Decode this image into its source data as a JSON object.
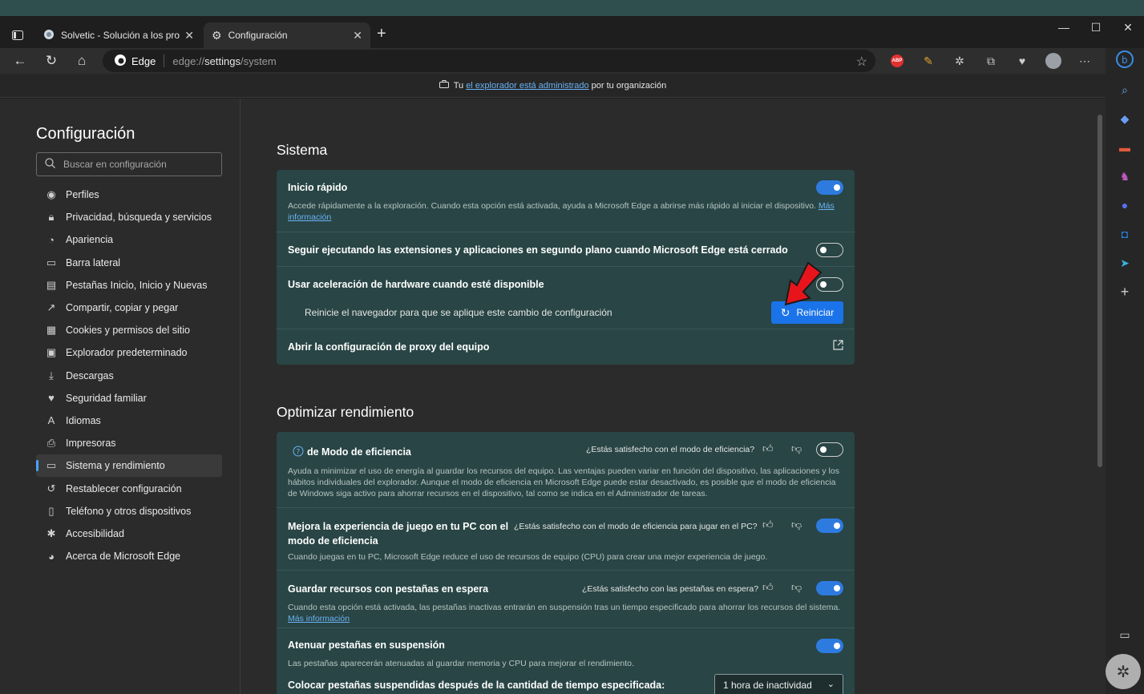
{
  "tabs": [
    {
      "title": "Solvetic - Solución a los problem",
      "active": false
    },
    {
      "title": "Configuración",
      "active": true
    }
  ],
  "toolbar": {
    "address_site": "Edge",
    "url_prefix": "edge://",
    "url_path": "settings",
    "url_suffix": "/system",
    "abp_label": "ABP"
  },
  "infobar": {
    "prefix": "Tu",
    "link": "el explorador está administrado",
    "suffix": "por tu organización"
  },
  "sidebar": {
    "title": "Configuración",
    "search_placeholder": "Buscar en configuración",
    "items": [
      {
        "label": "Perfiles",
        "icon": "profile-icon"
      },
      {
        "label": "Privacidad, búsqueda y servicios",
        "icon": "lock-icon"
      },
      {
        "label": "Apariencia",
        "icon": "palette-icon"
      },
      {
        "label": "Barra lateral",
        "icon": "sidebar-icon"
      },
      {
        "label": "Pestañas Inicio, Inicio y Nuevas",
        "icon": "tabs-icon"
      },
      {
        "label": "Compartir, copiar y pegar",
        "icon": "share-icon"
      },
      {
        "label": "Cookies y permisos del sitio",
        "icon": "cookie-icon"
      },
      {
        "label": "Explorador predeterminado",
        "icon": "browser-icon"
      },
      {
        "label": "Descargas",
        "icon": "download-icon"
      },
      {
        "label": "Seguridad familiar",
        "icon": "family-icon"
      },
      {
        "label": "Idiomas",
        "icon": "language-icon"
      },
      {
        "label": "Impresoras",
        "icon": "printer-icon"
      },
      {
        "label": "Sistema y rendimiento",
        "icon": "system-icon",
        "active": true
      },
      {
        "label": "Restablecer configuración",
        "icon": "reset-icon"
      },
      {
        "label": "Teléfono y otros dispositivos",
        "icon": "phone-icon"
      },
      {
        "label": "Accesibilidad",
        "icon": "accessibility-icon"
      },
      {
        "label": "Acerca de Microsoft Edge",
        "icon": "edge-logo-icon"
      }
    ]
  },
  "system": {
    "title": "Sistema",
    "startup_boost": {
      "title": "Inicio rápido",
      "desc": "Accede rápidamente a la exploración. Cuando esta opción está activada, ayuda a Microsoft Edge a abrirse más rápido al iniciar el dispositivo.",
      "link_a": "Más",
      "link_b": "información",
      "enabled": true
    },
    "background_apps": {
      "title": "Seguir ejecutando las extensiones y aplicaciones en segundo plano cuando Microsoft Edge está cerrado",
      "enabled": false
    },
    "hardware_accel": {
      "title": "Usar aceleración de hardware cuando esté disponible",
      "enabled": false,
      "restart_msg": "Reinicie el navegador para que se aplique este cambio de configuración",
      "restart_label": "Reiniciar"
    },
    "proxy": {
      "title": "Abrir la configuración de proxy del equipo"
    }
  },
  "performance": {
    "title": "Optimizar rendimiento",
    "efficiency": {
      "title": "de Modo de eficiencia",
      "question": "¿Estás satisfecho con el modo de eficiencia?",
      "desc1": "Ayuda a minimizar el uso de energía al guardar los recursos del equipo. Las ventajas pueden variar en función del dispositivo, las aplicaciones y los",
      "desc2": "hábitos individuales del explorador. Aunque el modo de eficiencia en Microsoft Edge puede estar desactivado, es posible que el modo de eficiencia",
      "desc3": "de Windows siga activo para ahorrar recursos en el dispositivo, tal como se indica en el Administrador de tareas.",
      "enabled": false
    },
    "gaming": {
      "title1": "Mejora la experiencia de juego en tu PC con el",
      "title2": "modo de eficiencia",
      "question": "¿Estás satisfecho con el modo de eficiencia para jugar en el PC?",
      "desc": "Cuando juegas en tu PC, Microsoft Edge reduce el uso de recursos de equipo (CPU) para crear una mejor experiencia de juego.",
      "enabled": true
    },
    "sleeping_tabs": {
      "title": "Guardar recursos con pestañas en espera",
      "question": "¿Estás satisfecho con las pestañas en espera?",
      "desc": "Cuando esta opción está activada, las pestañas inactivas entrarán en suspensión tras un tiempo especificado para ahorrar los recursos del sistema.",
      "link": "Más información",
      "enabled": true
    },
    "fade_tabs": {
      "title": "Atenuar pestañas en suspensión",
      "desc": "Las pestañas aparecerán atenuadas al guardar memoria y CPU para mejorar el rendimiento.",
      "enabled": true
    },
    "sleep_after": {
      "title": "Colocar pestañas suspendidas después de la cantidad de tiempo especificada:",
      "selected": "1 hora de inactividad"
    }
  },
  "colors": {
    "accent": "#2e7be0",
    "card_bg": "#294545",
    "arrow": "#e8141c"
  }
}
